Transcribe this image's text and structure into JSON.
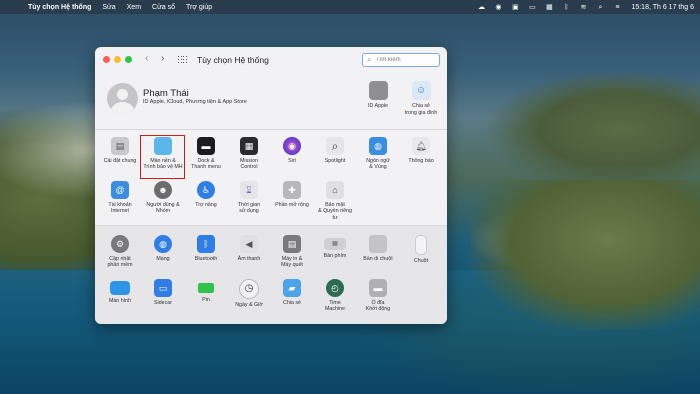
{
  "menubar": {
    "app_name": "Tùy chọn Hệ thống",
    "menus": [
      "Sửa",
      "Xem",
      "Cửa sổ",
      "Trợ giúp"
    ],
    "clock": "15:18, Th 6 17 thg 6"
  },
  "window": {
    "title": "Tùy chọn Hệ thống",
    "search_placeholder": "Tìm kiếm"
  },
  "user": {
    "name": "Phạm Thái",
    "subtitle": "ID Apple, iCloud, Phương tiện & App Store"
  },
  "top_items": [
    {
      "label": "ID Apple",
      "icon": "apple-icon",
      "color": "#8e8e93"
    },
    {
      "label": "Chia sẻ\ntrong gia đình",
      "icon": "family-icon",
      "color": "#dbe8f6"
    }
  ],
  "row1": [
    {
      "label": "Cài đặt chung",
      "icon": "general-icon",
      "color": "#c9c9cc"
    },
    {
      "label": "Màn nền &\nTrình bảo vệ MH",
      "icon": "desktop-icon",
      "color": "#5ab7e8"
    },
    {
      "label": "Dock &\nThanh menu",
      "icon": "dock-icon",
      "color": "#1c1c1e"
    },
    {
      "label": "Mission\nControl",
      "icon": "mission-control-icon",
      "color": "#2b2b2d"
    },
    {
      "label": "Siri",
      "icon": "siri-icon",
      "color": "#6a3fd6"
    },
    {
      "label": "Spotlight",
      "icon": "spotlight-icon",
      "color": "#e6e6e8"
    },
    {
      "label": "Ngôn ngữ\n& Vùng",
      "icon": "language-icon",
      "color": "#3a8de0"
    },
    {
      "label": "Thông báo",
      "icon": "notifications-icon",
      "color": "#f04747"
    }
  ],
  "row2": [
    {
      "label": "Tài khoản\nInternet",
      "icon": "at-icon",
      "color": "#3a8de0"
    },
    {
      "label": "Người dùng &\nNhóm",
      "icon": "users-icon",
      "color": "#6b6b70"
    },
    {
      "label": "Trợ năng",
      "icon": "accessibility-icon",
      "color": "#2f7ee6"
    },
    {
      "label": "Thời gian\nsử dụng",
      "icon": "hourglass-icon",
      "color": "#7b5fd3"
    },
    {
      "label": "Phần mở rộng",
      "icon": "extensions-icon",
      "color": "#b8b8bc"
    },
    {
      "label": "Bảo mật\n& Quyền riêng tư",
      "icon": "house-icon",
      "color": "#e0e0e3"
    }
  ],
  "row3": [
    {
      "label": "Cập nhật\nphần mềm",
      "icon": "gear-icon",
      "color": "#7a7a7e"
    },
    {
      "label": "Mạng",
      "icon": "network-icon",
      "color": "#2f7ee6"
    },
    {
      "label": "Bluetooth",
      "icon": "bluetooth-icon",
      "color": "#2f7ee6"
    },
    {
      "label": "Âm thanh",
      "icon": "speaker-icon",
      "color": "#8a8a8e"
    },
    {
      "label": "Máy in &\nMáy quét",
      "icon": "printer-icon",
      "color": "#7a7a7e"
    },
    {
      "label": "Bàn phím",
      "icon": "keyboard-icon",
      "color": "#d0d0d3"
    },
    {
      "label": "Bàn di chuột",
      "icon": "trackpad-icon",
      "color": "#c4c4c8"
    },
    {
      "label": "Chuột",
      "icon": "mouse-icon",
      "color": "#f4f4f6"
    }
  ],
  "row4": [
    {
      "label": "Màn hình",
      "icon": "display-icon",
      "color": "#2f95e6"
    },
    {
      "label": "Sidecar",
      "icon": "sidecar-icon",
      "color": "#2f7ee6"
    },
    {
      "label": "Pin",
      "icon": "battery-icon",
      "color": "#32c24d"
    },
    {
      "label": "Ngày & Giờ",
      "icon": "clock-icon",
      "color": "#f2f2f4"
    },
    {
      "label": "Chia sẻ",
      "icon": "sharing-icon",
      "color": "#4fa3e8"
    },
    {
      "label": "Time\nMachine",
      "icon": "time-machine-icon",
      "color": "#2e6b55"
    },
    {
      "label": "Ổ đĩa\nKhởi động",
      "icon": "disk-icon",
      "color": "#b0b0b4"
    }
  ]
}
